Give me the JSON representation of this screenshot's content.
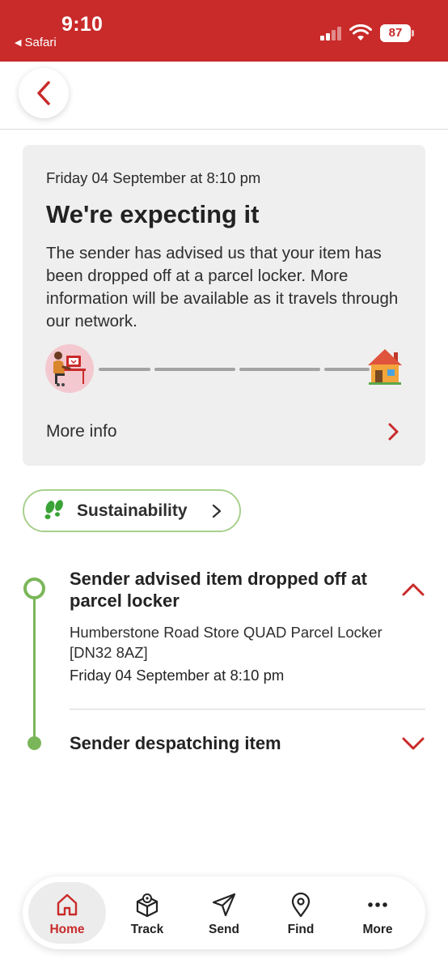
{
  "status_bar": {
    "time": "9:10",
    "back_app": "Safari",
    "battery": "87"
  },
  "card": {
    "date": "Friday 04 September at 8:10 pm",
    "title": "We're expecting it",
    "description": "The sender has advised us that your item has been dropped off at a parcel locker. More information will be available as it travels through our network.",
    "more_info_label": "More info"
  },
  "sustainability": {
    "label": "Sustainability"
  },
  "timeline": {
    "events": [
      {
        "title": "Sender advised item dropped off at parcel locker",
        "location": "Humberstone Road Store QUAD Parcel Locker [DN32 8AZ]",
        "date": "Friday 04 September at 8:10 pm",
        "expanded": true
      },
      {
        "title": "Sender despatching item",
        "expanded": false
      }
    ]
  },
  "tabbar": {
    "tabs": [
      {
        "label": "Home",
        "icon": "home-icon",
        "active": true
      },
      {
        "label": "Track",
        "icon": "parcel-icon",
        "active": false
      },
      {
        "label": "Send",
        "icon": "paper-plane-icon",
        "active": false
      },
      {
        "label": "Find",
        "icon": "location-pin-icon",
        "active": false
      },
      {
        "label": "More",
        "icon": "ellipsis-icon",
        "active": false
      }
    ]
  },
  "colors": {
    "brand_red": "#c92a2a",
    "timeline_green": "#7ab659",
    "pill_border_green": "#a8d08d",
    "card_bg": "#efefef"
  }
}
